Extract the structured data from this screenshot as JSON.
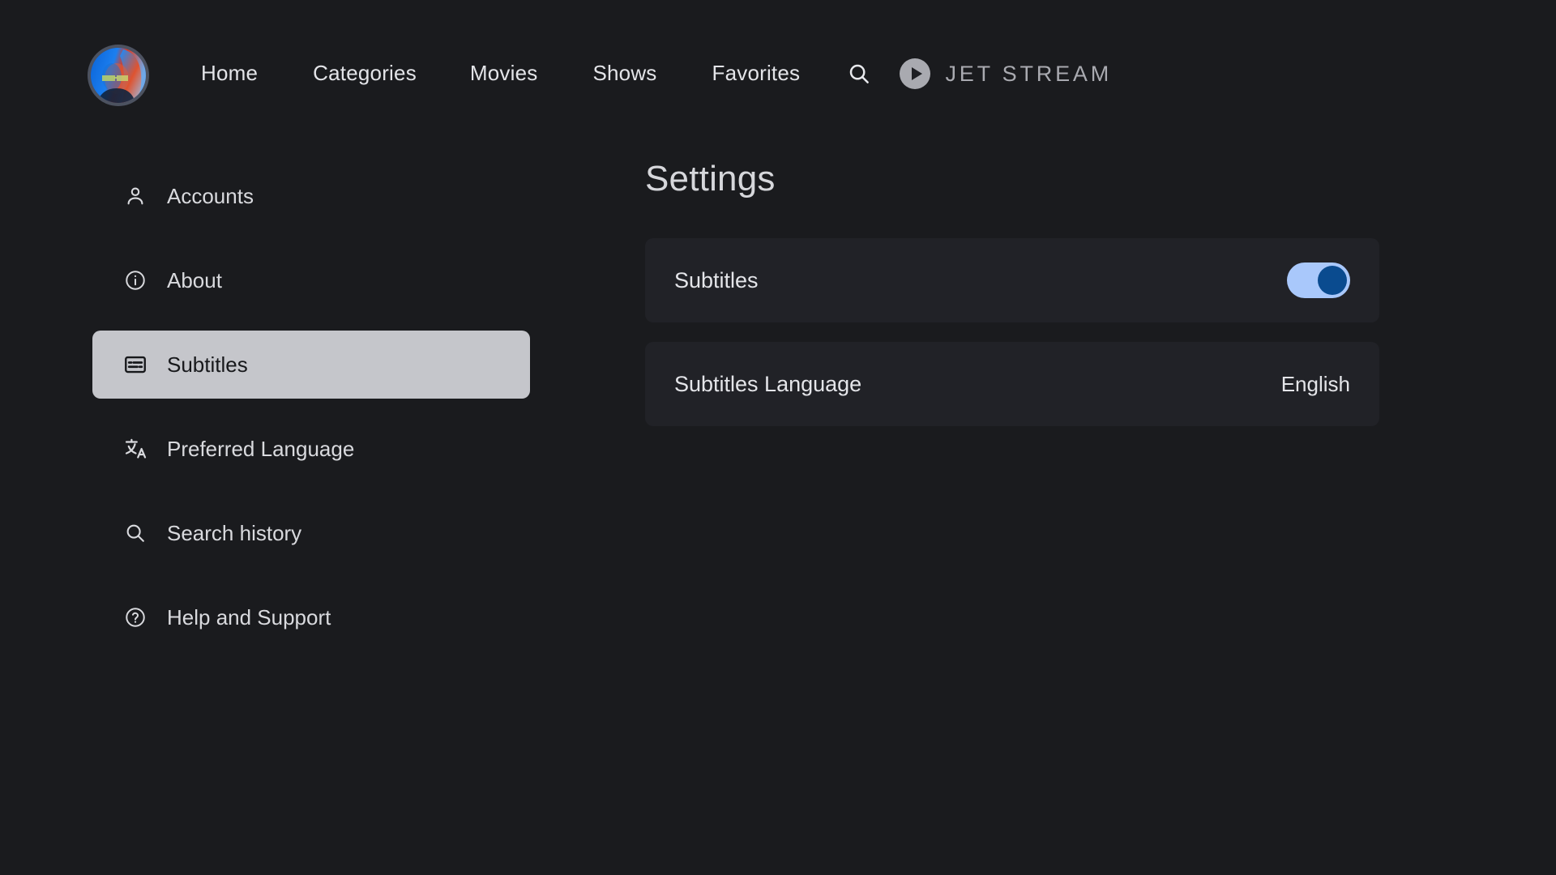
{
  "brand": {
    "name": "JET STREAM",
    "mark_icon": "play-circle-icon"
  },
  "avatar": {
    "icon": "user-avatar",
    "alt": "User profile portrait"
  },
  "nav": {
    "items": [
      {
        "label": "Home"
      },
      {
        "label": "Categories"
      },
      {
        "label": "Movies"
      },
      {
        "label": "Shows"
      },
      {
        "label": "Favorites"
      }
    ],
    "search_icon": "search-icon"
  },
  "sidebar": {
    "items": [
      {
        "label": "Accounts",
        "icon": "person-icon",
        "active": false
      },
      {
        "label": "About",
        "icon": "info-circle-icon",
        "active": false
      },
      {
        "label": "Subtitles",
        "icon": "subtitles-icon",
        "active": true
      },
      {
        "label": "Preferred Language",
        "icon": "translate-icon",
        "active": false
      },
      {
        "label": "Search history",
        "icon": "search-icon",
        "active": false
      },
      {
        "label": "Help and Support",
        "icon": "help-circle-icon",
        "active": false
      }
    ]
  },
  "main": {
    "title": "Settings",
    "settings": [
      {
        "label": "Subtitles",
        "control": "toggle",
        "value": "on"
      },
      {
        "label": "Subtitles Language",
        "control": "value",
        "value": "English"
      }
    ]
  },
  "colors": {
    "page_background": "#1a1b1e",
    "card_background": "#212227",
    "active_item_background": "#c5c6cb",
    "text_primary": "#e4e5e9",
    "text_muted": "#a9aab0",
    "toggle_track_on": "#a9c8fb",
    "toggle_knob_on": "#0a4b8f"
  }
}
